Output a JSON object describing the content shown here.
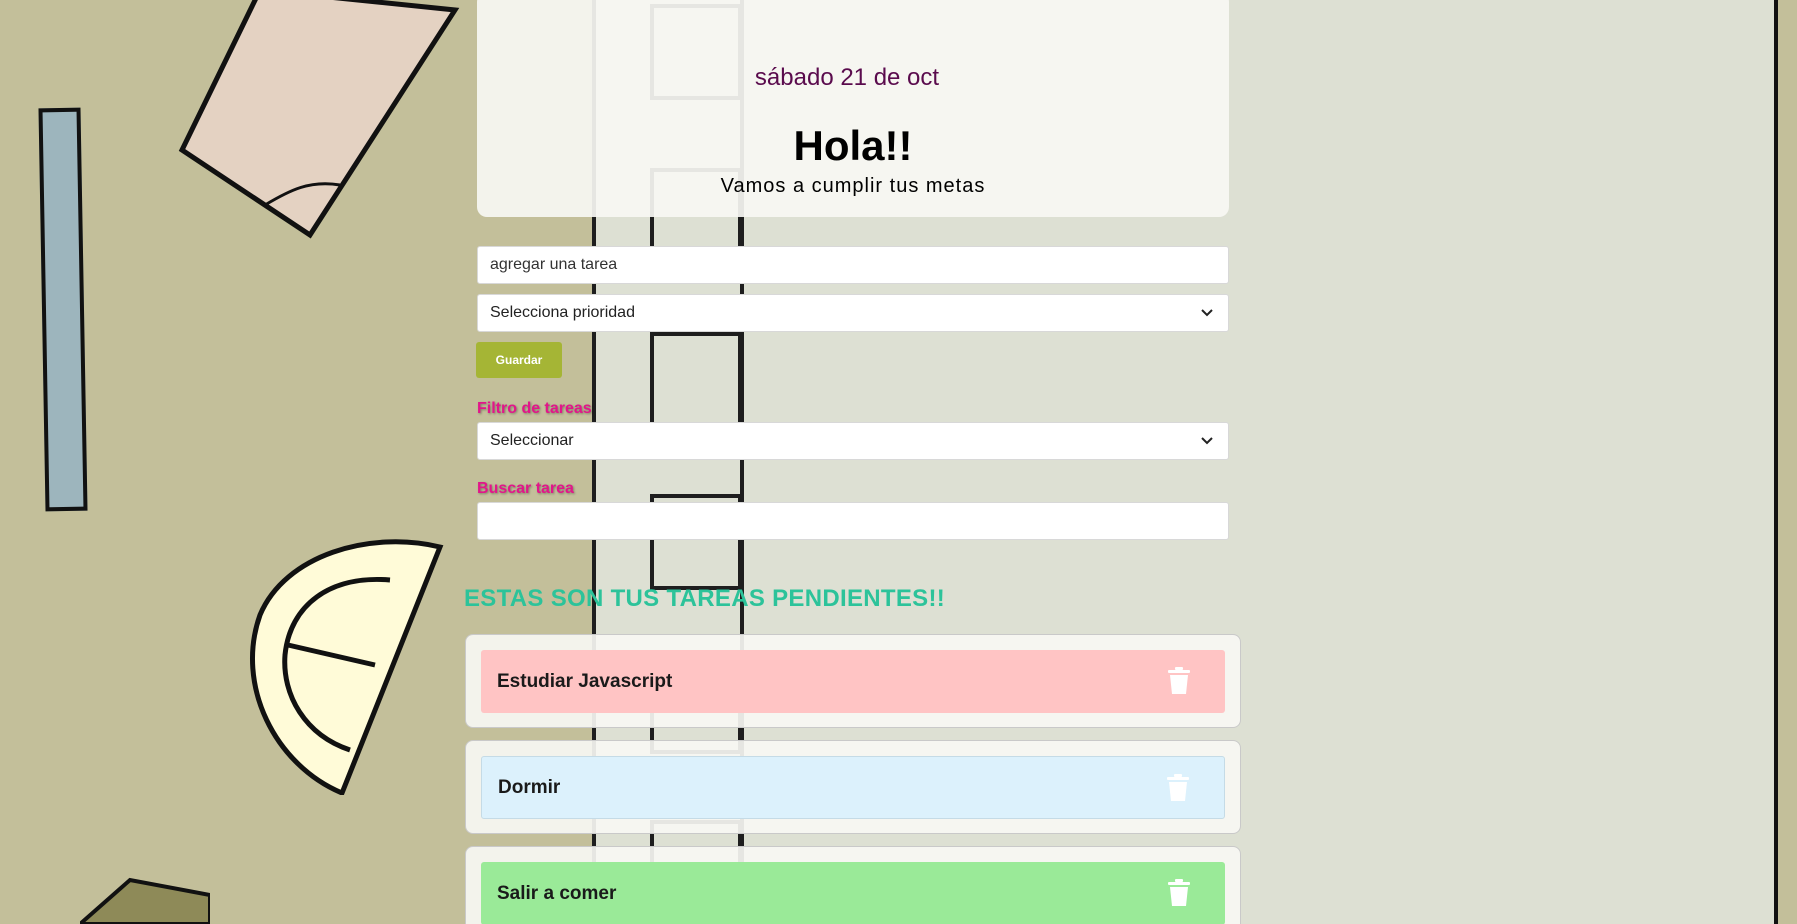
{
  "header": {
    "date": "sábado 21 de oct",
    "greeting": "Hola!!",
    "subtitle": "Vamos a cumplir tus metas"
  },
  "form": {
    "task_placeholder": "agregar una tarea",
    "priority_select": "Selecciona prioridad",
    "save_label": "Guardar"
  },
  "filter": {
    "label": "Filtro de tareas",
    "select_value": "Seleccionar"
  },
  "search": {
    "label": "Buscar tarea",
    "value": ""
  },
  "tasks": {
    "title": "ESTAS SON TUS TAREAS PENDIENTES!!",
    "items": [
      {
        "name": "Estudiar Javascript",
        "color": "#ffc4c4"
      },
      {
        "name": "Dormir",
        "color": "#dcf1fc"
      },
      {
        "name": "Salir a comer",
        "color": "#9aea98"
      }
    ]
  },
  "colors": {
    "accent_pink": "#e2168a",
    "accent_green": "#2cc39a",
    "button": "#a5b535",
    "date_color": "#5a0b4d"
  }
}
